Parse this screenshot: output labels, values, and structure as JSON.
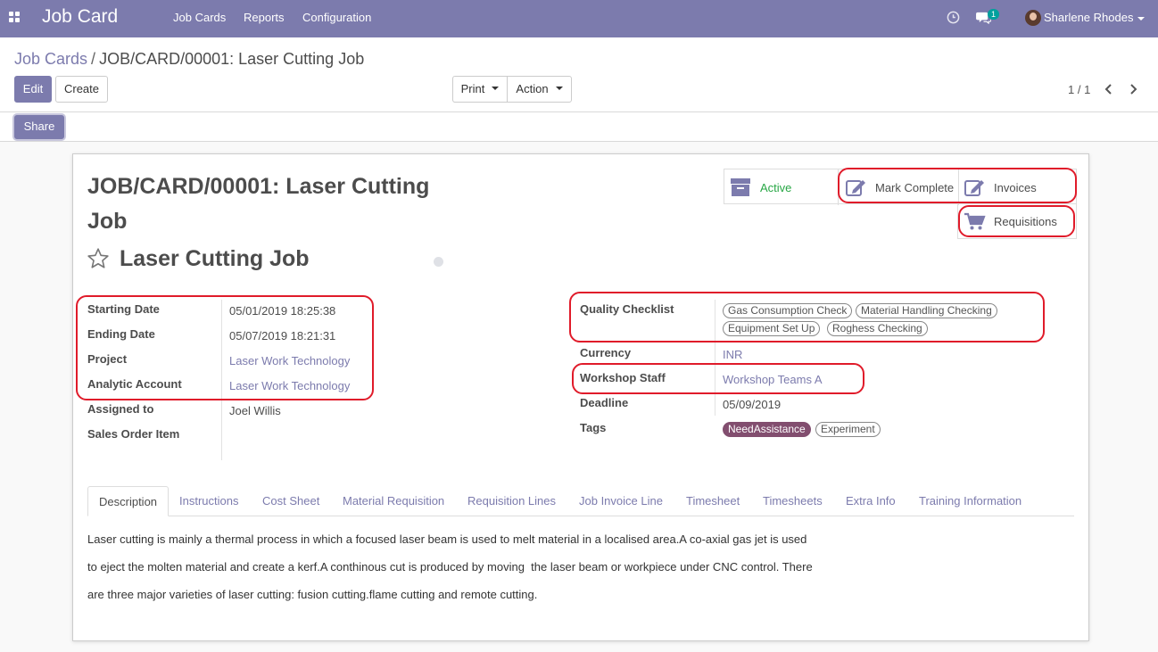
{
  "navbar": {
    "brand": "Job Card",
    "menu": [
      "Job Cards",
      "Reports",
      "Configuration"
    ],
    "messages_badge": "1",
    "user_name": "Sharlene Rhodes"
  },
  "breadcrumb": {
    "parent": "Job Cards",
    "separator": "/",
    "current": "JOB/CARD/00001: Laser Cutting Job"
  },
  "toolbar": {
    "edit": "Edit",
    "create": "Create",
    "print": "Print",
    "action": "Action",
    "share": "Share"
  },
  "pager": {
    "text": "1 / 1"
  },
  "record": {
    "title": "JOB/CARD/00001: Laser Cutting Job",
    "name": "Laser Cutting Job"
  },
  "smart_buttons": {
    "active": "Active",
    "mark_complete": "Mark Complete",
    "invoices": "Invoices",
    "requisitions": "Requisitions"
  },
  "left_fields": [
    {
      "label": "Starting Date",
      "value": "05/01/2019 18:25:38",
      "link": false
    },
    {
      "label": "Ending Date",
      "value": "05/07/2019 18:21:31",
      "link": false
    },
    {
      "label": "Project",
      "value": "Laser Work Technology",
      "link": true
    },
    {
      "label": "Analytic Account",
      "value": "Laser Work Technology",
      "link": true
    },
    {
      "label": "Assigned to",
      "value": "Joel Willis",
      "link": false
    },
    {
      "label": "Sales Order Item",
      "value": "",
      "link": false
    }
  ],
  "right_fields": {
    "quality_checklist_label": "Quality Checklist",
    "quality_checklist_tags": [
      "Gas Consumption Check",
      "Material Handling Checking",
      "Equipment Set Up",
      "Roghess Checking"
    ],
    "currency_label": "Currency",
    "currency_value": "INR",
    "workshop_staff_label": "Workshop Staff",
    "workshop_staff_value": "Workshop Teams A",
    "deadline_label": "Deadline",
    "deadline_value": "05/09/2019",
    "tags_label": "Tags",
    "tags": [
      "NeedAssistance",
      "Experiment"
    ]
  },
  "tabs": [
    "Description",
    "Instructions",
    "Cost Sheet",
    "Material Requisition",
    "Requisition Lines",
    "Job Invoice Line",
    "Timesheet",
    "Timesheets",
    "Extra Info",
    "Training Information"
  ],
  "description_lines": [
    "Laser cutting is mainly a thermal process in which a focused laser beam is used to melt material in a localised area.A co-axial gas jet is used",
    "to eject the molten material and create a kerf.A conthinous cut is produced by moving  the laser beam or workpiece under CNC control. There",
    "are three major varieties of laser cutting: fusion cutting.flame cutting and remote cutting."
  ],
  "colors": {
    "brand": "#7c7bad",
    "active_status": "#28a745",
    "highlight": "#e01b2a",
    "tag_filled": "#824e6f"
  },
  "icons": [
    "apps-icon",
    "clock-icon",
    "chat-icon",
    "star-icon",
    "archive-icon",
    "edit-icon",
    "cart-icon",
    "chevron-left-icon",
    "chevron-right-icon"
  ]
}
